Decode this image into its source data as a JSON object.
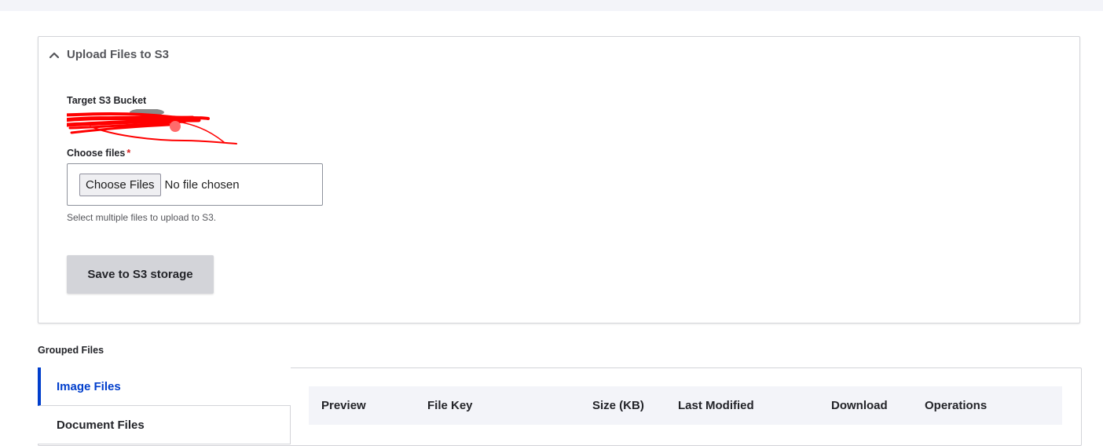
{
  "upload_panel": {
    "title": "Upload Files to S3",
    "bucket_label": "Target S3 Bucket",
    "files_label": "Choose files",
    "required_mark": "*",
    "file_input": {
      "button_label": "Choose Files",
      "status": "No file chosen"
    },
    "help_text": "Select multiple files to upload to S3.",
    "save_label": "Save to S3 storage"
  },
  "grouped": {
    "title": "Grouped Files",
    "tabs": [
      {
        "label": "Image Files",
        "active": true
      },
      {
        "label": "Document Files",
        "active": false
      }
    ],
    "columns": [
      "Preview",
      "File Key",
      "Size (KB)",
      "Last Modified",
      "Download",
      "Operations"
    ]
  },
  "colors": {
    "accent": "#003ecc",
    "redaction": "#ff0000",
    "required": "#d72222"
  },
  "icons": {
    "collapse": "chevron-up-icon"
  }
}
